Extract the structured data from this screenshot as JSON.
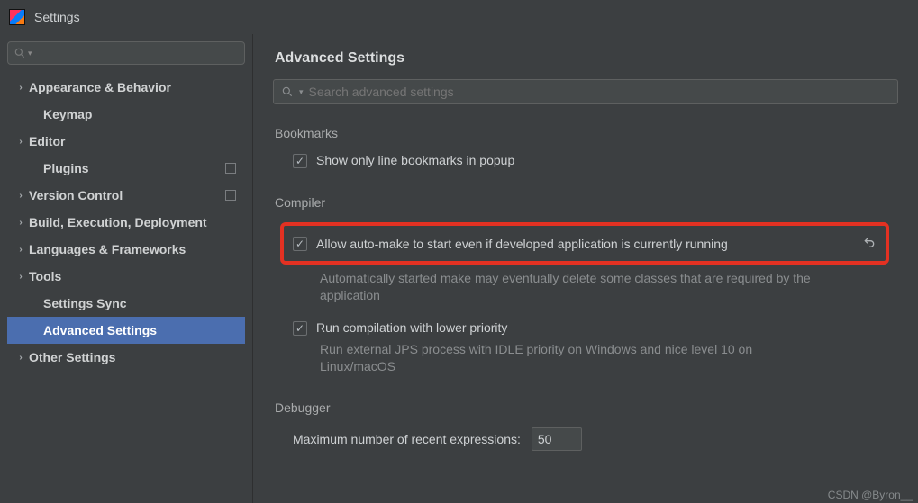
{
  "window": {
    "title": "Settings"
  },
  "content": {
    "title": "Advanced Settings",
    "search_placeholder": "Search advanced settings"
  },
  "sidebar": {
    "items": [
      {
        "label": "Appearance & Behavior",
        "chevron": true,
        "badge": false
      },
      {
        "label": "Keymap",
        "chevron": false,
        "badge": false,
        "child": true
      },
      {
        "label": "Editor",
        "chevron": true,
        "badge": false
      },
      {
        "label": "Plugins",
        "chevron": false,
        "badge": true,
        "child": true
      },
      {
        "label": "Version Control",
        "chevron": true,
        "badge": true
      },
      {
        "label": "Build, Execution, Deployment",
        "chevron": true,
        "badge": false
      },
      {
        "label": "Languages & Frameworks",
        "chevron": true,
        "badge": false
      },
      {
        "label": "Tools",
        "chevron": true,
        "badge": false
      },
      {
        "label": "Settings Sync",
        "chevron": false,
        "badge": false,
        "child": true
      },
      {
        "label": "Advanced Settings",
        "chevron": false,
        "badge": false,
        "child": true,
        "selected": true
      },
      {
        "label": "Other Settings",
        "chevron": true,
        "badge": false
      }
    ]
  },
  "sections": {
    "bookmarks": {
      "heading": "Bookmarks",
      "option1_label": "Show only line bookmarks in popup"
    },
    "compiler": {
      "heading": "Compiler",
      "option1_label": "Allow auto-make to start even if developed application is currently running",
      "option1_desc": "Automatically started make may eventually delete some classes that are required by the application",
      "option2_label": "Run compilation with lower priority",
      "option2_desc": "Run external JPS process with IDLE priority on Windows and nice level 10 on Linux/macOS"
    },
    "debugger": {
      "heading": "Debugger",
      "field1_label": "Maximum number of recent expressions:",
      "field1_value": "50"
    }
  },
  "watermark": "CSDN @Byron__"
}
